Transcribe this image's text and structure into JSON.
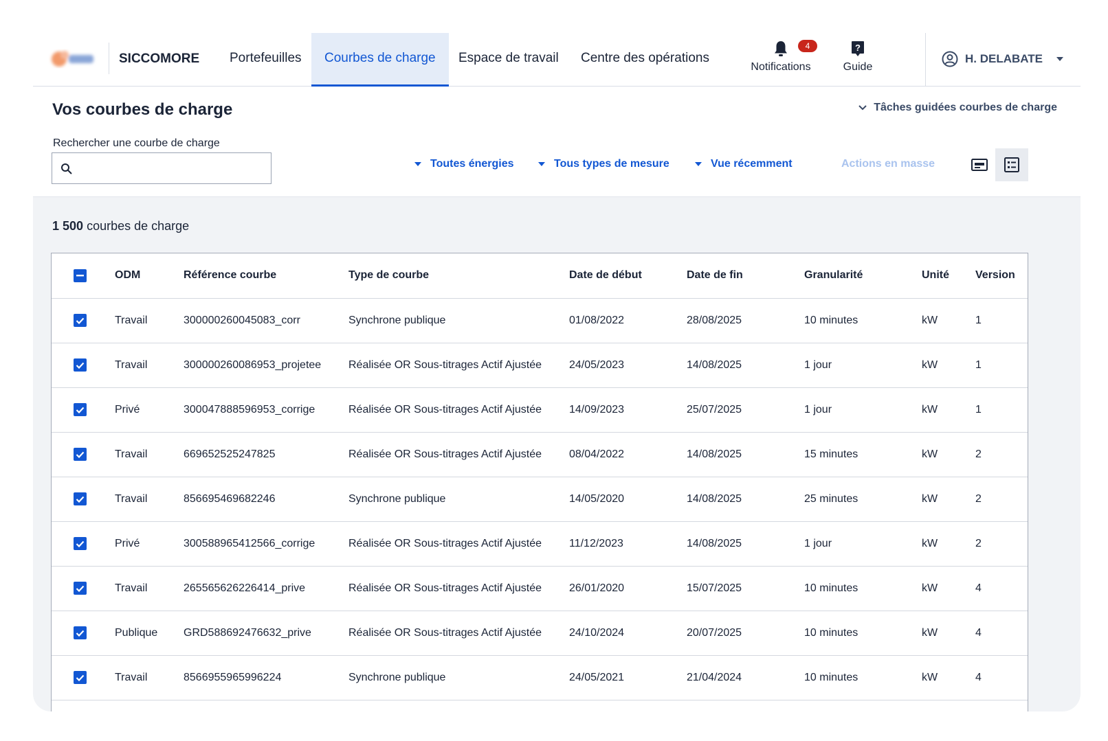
{
  "header": {
    "app_name": "SICCOMORE",
    "nav": [
      {
        "label": "Portefeuilles",
        "active": false
      },
      {
        "label": "Courbes de charge",
        "active": true
      },
      {
        "label": "Espace de travail",
        "active": false
      },
      {
        "label": "Centre des opérations",
        "active": false
      }
    ],
    "notifications": {
      "label": "Notifications",
      "count": "4",
      "icon": "bell-icon"
    },
    "guide": {
      "label": "Guide",
      "icon": "help-icon"
    },
    "user": {
      "name": "H. DELABATE",
      "icon": "user-circle-icon"
    }
  },
  "page": {
    "title": "Vos courbes de charge",
    "guided_tasks": "Tâches guidées courbes de charge",
    "search": {
      "label": "Rechercher une courbe de charge",
      "value": "",
      "placeholder": ""
    },
    "filters": {
      "energy": "Toutes énergies",
      "measure": "Tous types de mesure",
      "recent": "Vue récemment"
    },
    "mass_actions": "Actions en masse",
    "count": {
      "value": "1 500",
      "label": "courbes de charge"
    }
  },
  "colors": {
    "accent": "#1257d3",
    "badge": "#c8261b",
    "content_bg": "#f1f3f6"
  },
  "table": {
    "columns": [
      "ODM",
      "Référence courbe",
      "Type de courbe",
      "Date de début",
      "Date de fin",
      "Granularité",
      "Unité",
      "Version"
    ],
    "rows": [
      [
        "Travail",
        "300000260045083_corr",
        "Synchrone publique",
        "01/08/2022",
        "28/08/2025",
        "10 minutes",
        "kW",
        "1"
      ],
      [
        "Travail",
        "300000260086953_projetee",
        "Réalisée OR Sous-titrages Actif Ajustée",
        "24/05/2023",
        "14/08/2025",
        "1 jour",
        "kW",
        "1"
      ],
      [
        "Privé",
        "300047888596953_corrige",
        "Réalisée OR Sous-titrages Actif Ajustée",
        "14/09/2023",
        "25/07/2025",
        "1 jour",
        "kW",
        "1"
      ],
      [
        "Travail",
        "669652525247825",
        "Réalisée OR Sous-titrages Actif Ajustée",
        "08/04/2022",
        "14/08/2025",
        "15 minutes",
        "kW",
        "2"
      ],
      [
        "Travail",
        "856695469682246",
        "Synchrone publique",
        "14/05/2020",
        "14/08/2025",
        "25 minutes",
        "kW",
        "2"
      ],
      [
        "Privé",
        "300588965412566_corrige",
        "Réalisée OR Sous-titrages Actif Ajustée",
        "11/12/2023",
        "14/08/2025",
        "1 jour",
        "kW",
        "2"
      ],
      [
        "Travail",
        "265565626226414_prive",
        "Réalisée OR Sous-titrages Actif Ajustée",
        "26/01/2020",
        "15/07/2025",
        "10 minutes",
        "kW",
        "4"
      ],
      [
        "Publique",
        "GRD588692476632_prive",
        "Réalisée OR Sous-titrages Actif Ajustée",
        "24/10/2024",
        "20/07/2025",
        "10 minutes",
        "kW",
        "4"
      ],
      [
        "Travail",
        "8566955965996224",
        "Synchrone publique",
        "24/05/2021",
        "21/04/2024",
        "10 minutes",
        "kW",
        "4"
      ]
    ]
  }
}
